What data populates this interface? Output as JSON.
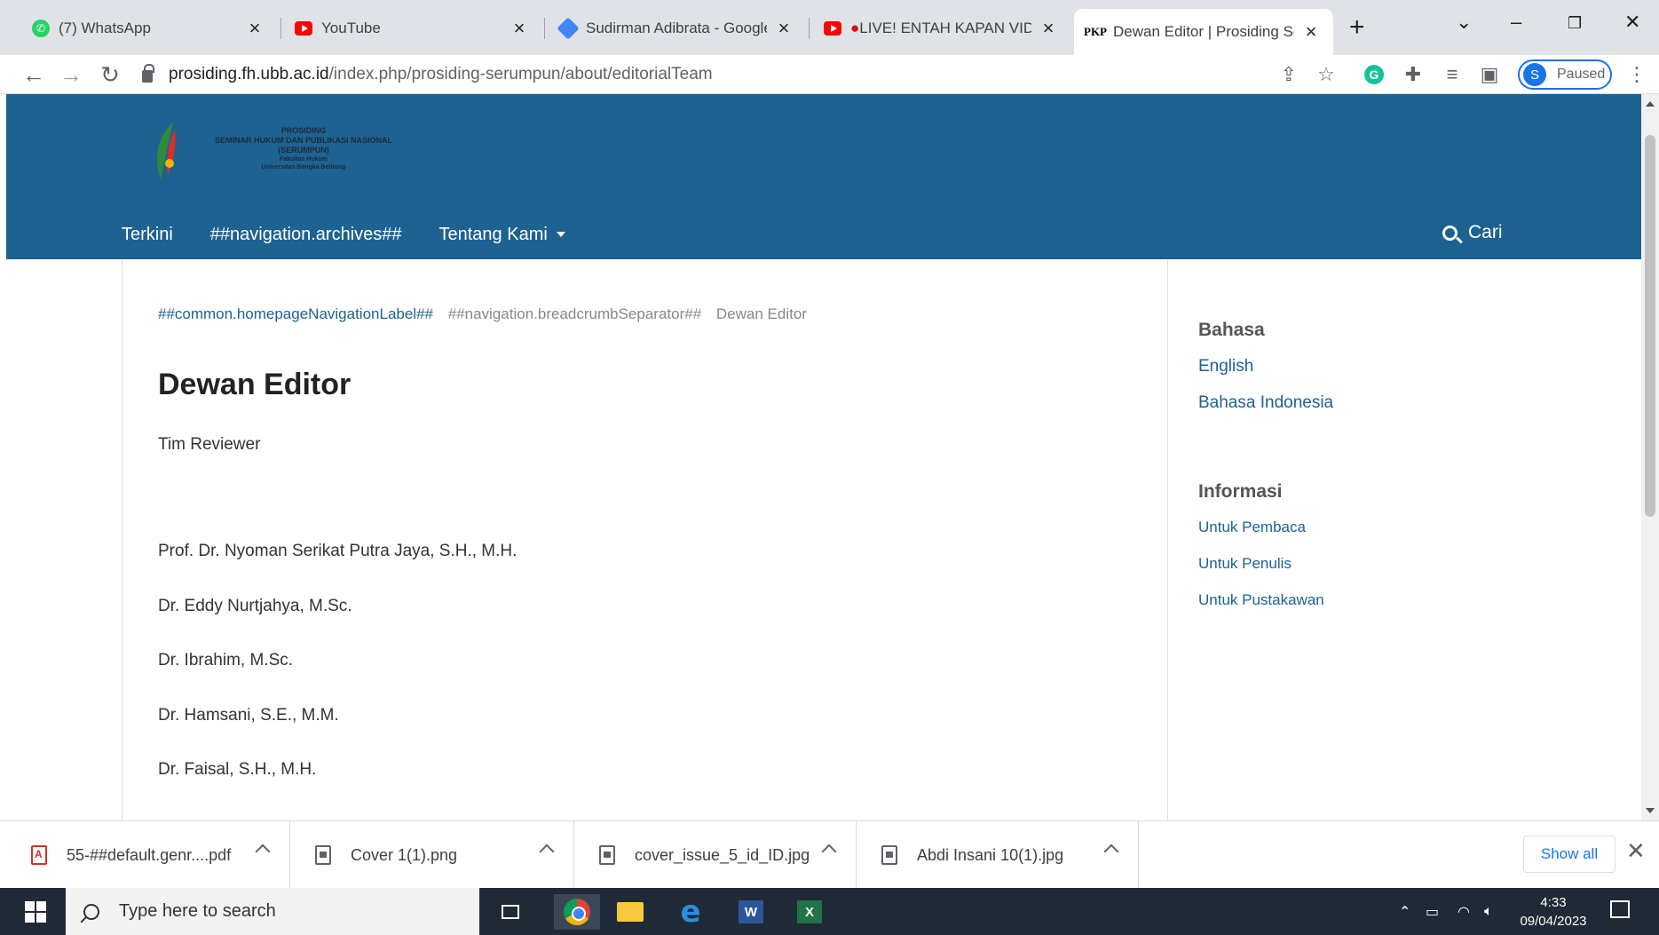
{
  "browser": {
    "tabs": [
      {
        "title": "(7) WhatsApp",
        "icon": "whatsapp-icon"
      },
      {
        "title": "YouTube",
        "icon": "youtube-icon"
      },
      {
        "title": "Sudirman Adibrata - Google",
        "icon": "google-scholar-icon"
      },
      {
        "title": "LIVE! ENTAH KAPAN VIDE",
        "icon": "youtube-icon"
      },
      {
        "title": "Dewan Editor | Prosiding Ser",
        "icon": "pkp-icon",
        "favicon_text": "PKP",
        "active": true
      }
    ],
    "url_host": "prosiding.fh.ubb.ac.id",
    "url_path": "/index.php/prosiding-serumpun/about/editorialTeam",
    "profile_initial": "S",
    "profile_status": "Paused"
  },
  "site": {
    "logo_lines": [
      "PROSIDING",
      "SEMINAR HUKUM DAN PUBLIKASI NASIONAL",
      "(SERUMPUN)",
      "Fakultas Hukum",
      "Universitas Bangka Belitung"
    ],
    "header_color": "#1e6292",
    "nav": {
      "home": "Terkini",
      "archives": "##navigation.archives##",
      "about": "Tentang Kami",
      "search": "Cari"
    }
  },
  "main": {
    "breadcrumb": {
      "home": "##common.homepageNavigationLabel##",
      "separator": "##navigation.breadcrumbSeparator##",
      "current": "Dewan Editor"
    },
    "title": "Dewan Editor",
    "subtitle": "Tim Reviewer",
    "members": [
      "Prof. Dr. Nyoman Serikat Putra Jaya, S.H., M.H.",
      "Dr. Eddy Nurtjahya, M.Sc.",
      "Dr. Ibrahim, M.Sc.",
      "Dr. Hamsani, S.E., M.M.",
      "Dr. Faisal, S.H., M.H."
    ]
  },
  "sidebar": {
    "language_heading": "Bahasa",
    "languages": [
      "English",
      "Bahasa Indonesia"
    ],
    "info_heading": "Informasi",
    "info_links": [
      "Untuk Pembaca",
      "Untuk Penulis",
      "Untuk Pustakawan"
    ]
  },
  "downloads": {
    "items": [
      {
        "name": "55-##default.genr....pdf",
        "type": "pdf"
      },
      {
        "name": "Cover 1(1).png",
        "type": "image"
      },
      {
        "name": "cover_issue_5_id_ID.jpg",
        "type": "image"
      },
      {
        "name": "Abdi Insani 10(1).jpg",
        "type": "image"
      }
    ],
    "show_all": "Show all"
  },
  "taskbar": {
    "search_placeholder": "Type here to search",
    "time": "4:33",
    "date": "09/04/2023"
  }
}
